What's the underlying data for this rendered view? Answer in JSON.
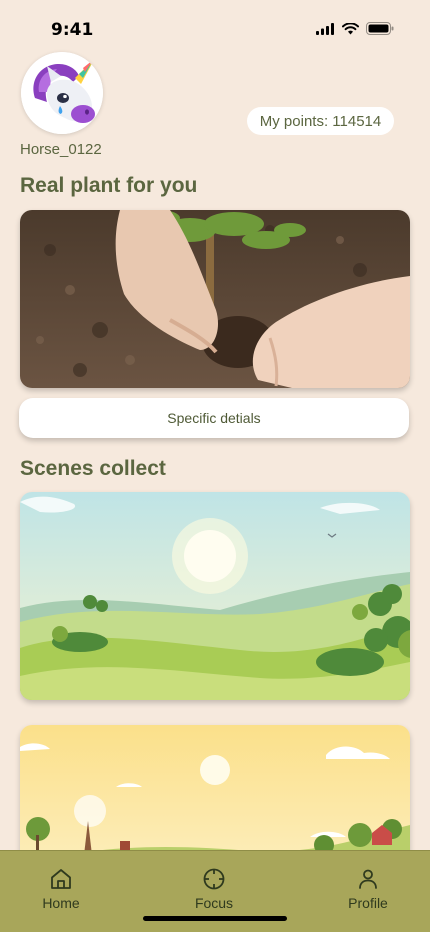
{
  "status": {
    "time": "9:41"
  },
  "profile": {
    "username": "Horse_0122",
    "points": "My points: 114514"
  },
  "real_plant": {
    "title": "Real plant for you",
    "button_label": "Specific detials"
  },
  "scenes": {
    "title": "Scenes collect"
  },
  "tabs": [
    {
      "label": "Home",
      "icon": "home-icon"
    },
    {
      "label": "Focus",
      "icon": "crosshair-icon"
    },
    {
      "label": "Profile",
      "icon": "person-icon"
    }
  ],
  "colors": {
    "background": "#f6e9dd",
    "accent_text": "#5b6640",
    "tab_bar": "#a8a65a"
  }
}
